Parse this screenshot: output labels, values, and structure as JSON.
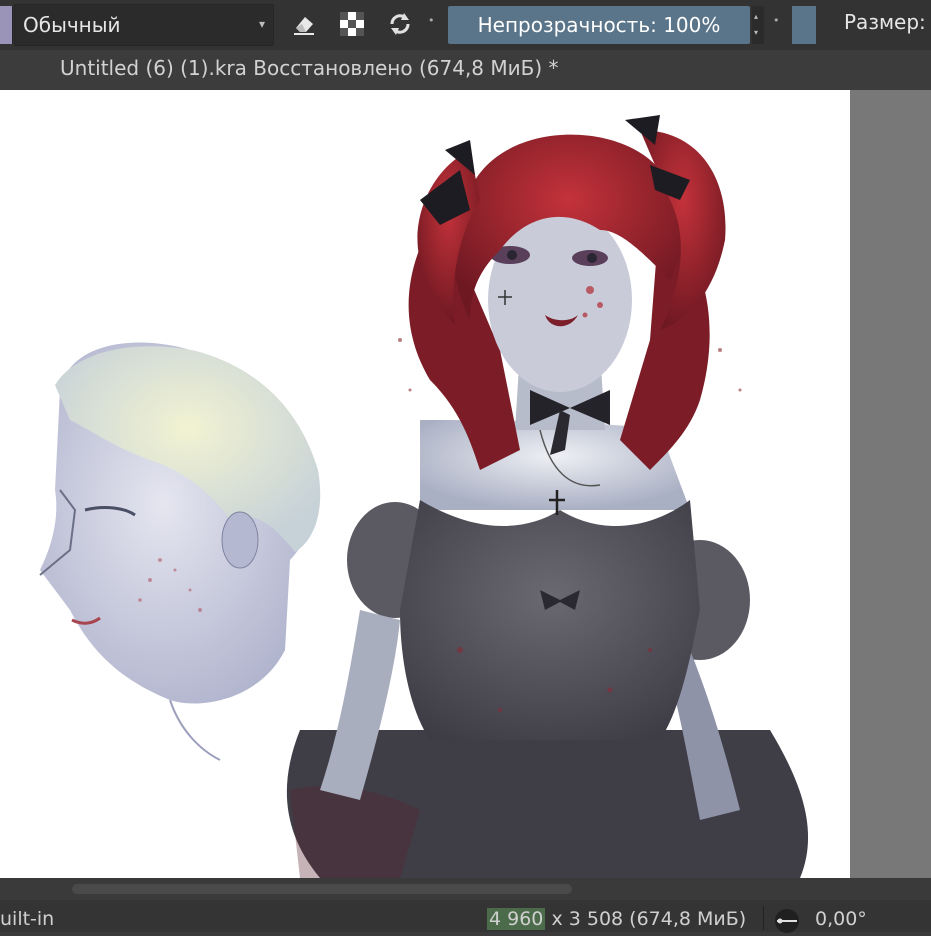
{
  "toolbar": {
    "blend_mode": "Обычный",
    "opacity_label": "Непрозрачность: 100%",
    "size_label": "Размер:",
    "icons": [
      "eraser-icon",
      "alpha-lock-icon",
      "reload-preset-icon"
    ]
  },
  "document": {
    "tab_title": "Untitled (6) (1).kra Восстановлено  (674,8 МиБ)  *"
  },
  "status": {
    "left_text": "uilt-in",
    "dims_width": "4 960",
    "dims_rest": " x 3 508 (674,8 МиБ)",
    "rotation": "0,00°"
  },
  "colors": {
    "accent": "#5a7489",
    "toolbar_bg": "#333333",
    "canvas_bg": "#787878"
  }
}
